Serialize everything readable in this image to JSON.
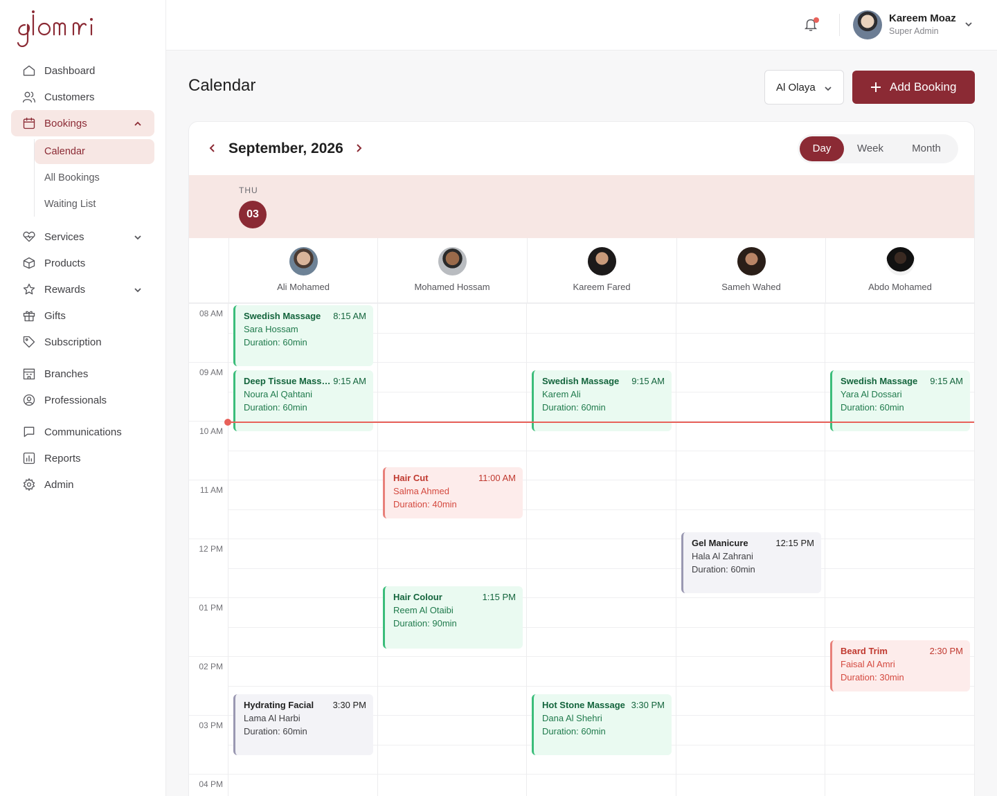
{
  "brand": {
    "logo_text": "glomi",
    "accent": "#8b2a34"
  },
  "sidebar": {
    "items": [
      {
        "label": "Dashboard",
        "icon": "home-icon"
      },
      {
        "label": "Customers",
        "icon": "users-icon"
      },
      {
        "label": "Bookings",
        "icon": "calendar-icon",
        "active": true,
        "expanded": true
      },
      {
        "label": "Services",
        "icon": "heart-pulse-icon"
      },
      {
        "label": "Products",
        "icon": "box-icon"
      },
      {
        "label": "Rewards",
        "icon": "star-icon"
      },
      {
        "label": "Gifts",
        "icon": "gift-icon"
      },
      {
        "label": "Subscription",
        "icon": "tag-icon"
      },
      {
        "label": "Branches",
        "icon": "building-icon"
      },
      {
        "label": "Professionals",
        "icon": "user-circle-icon"
      },
      {
        "label": "Communications",
        "icon": "chat-icon"
      },
      {
        "label": "Reports",
        "icon": "chart-icon"
      },
      {
        "label": "Admin",
        "icon": "gear-icon"
      }
    ],
    "bookings_sub": [
      {
        "label": "Calendar",
        "active": true
      },
      {
        "label": "All Bookings"
      },
      {
        "label": "Waiting List"
      }
    ]
  },
  "topbar": {
    "user_name": "Kareem Moaz",
    "user_role": "Super Admin",
    "has_notification": true
  },
  "page": {
    "title": "Calendar",
    "branch": "Al Olaya",
    "add_label": "Add Booking"
  },
  "calendar": {
    "month_label": "September, 2026",
    "views": [
      "Day",
      "Week",
      "Month"
    ],
    "active_view": "Day",
    "day_of_week": "THU",
    "day_number": "03",
    "time_labels": [
      "08 AM",
      "09 AM",
      "10 AM",
      "11 AM",
      "12 PM",
      "01 PM",
      "02 PM",
      "03 PM",
      "04 PM"
    ],
    "staff": [
      "Ali Mohamed",
      "Mohamed Hossam",
      "Kareem Fared",
      "Sameh Wahed",
      "Abdo Mohamed"
    ],
    "events": [
      {
        "title": "Swedish Massage",
        "time": "8:15 AM",
        "client": "Sara Hossam",
        "duration": "Duration: 60min",
        "style": "green",
        "staff": 0
      },
      {
        "title": "Deep Tissue Massa...",
        "time": "9:15 AM",
        "client": "Noura Al Qahtani",
        "duration": "Duration: 60min",
        "style": "green",
        "staff": 0
      },
      {
        "title": "Hydrating Facial",
        "time": "3:30 PM",
        "client": "Lama Al Harbi",
        "duration": "Duration: 60min",
        "style": "gray",
        "staff": 0
      },
      {
        "title": "Hair Cut",
        "time": "11:00 AM",
        "client": "Salma Ahmed",
        "duration": "Duration: 40min",
        "style": "red",
        "staff": 1
      },
      {
        "title": "Hair Colour",
        "time": "1:15 PM",
        "client": "Reem Al Otaibi",
        "duration": "Duration: 90min",
        "style": "green",
        "staff": 1
      },
      {
        "title": "Swedish Massage",
        "time": "9:15 AM",
        "client": "Karem Ali",
        "duration": "Duration: 60min",
        "style": "green",
        "staff": 2
      },
      {
        "title": "Hot Stone Massage",
        "time": "3:30 PM",
        "client": "Dana Al Shehri",
        "duration": "Duration: 60min",
        "style": "green",
        "staff": 2
      },
      {
        "title": "Gel Manicure",
        "time": "12:15 PM",
        "client": "Hala Al Zahrani",
        "duration": "Duration: 60min",
        "style": "gray",
        "staff": 3
      },
      {
        "title": "Swedish Massage",
        "time": "9:15 AM",
        "client": "Yara Al Dossari",
        "duration": "Duration: 60min",
        "style": "green",
        "staff": 4
      },
      {
        "title": "Beard Trim",
        "time": "2:30 PM",
        "client": "Faisal Al Amri",
        "duration": "Duration: 30min",
        "style": "red",
        "staff": 4
      }
    ]
  }
}
